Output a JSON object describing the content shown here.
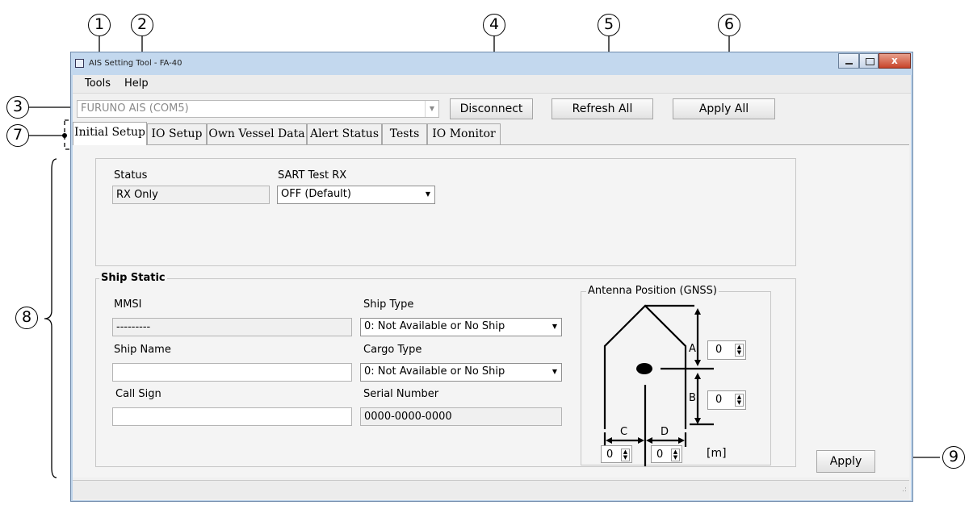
{
  "callouts": [
    "1",
    "2",
    "3",
    "4",
    "5",
    "6",
    "7",
    "8",
    "9"
  ],
  "window": {
    "title": "AIS Setting Tool - FA-40",
    "buttons": [
      "minimize-button",
      "maximize-button",
      "close-button"
    ]
  },
  "menu": {
    "tools": "Tools",
    "help": "Help"
  },
  "toolbar": {
    "port_value": "FURUNO AIS (COM5)",
    "disconnect": "Disconnect",
    "refresh_all": "Refresh All",
    "apply_all": "Apply All"
  },
  "tabs": [
    "Initial Setup",
    "IO Setup",
    "Own Vessel Data",
    "Alert Status",
    "Tests",
    "IO Monitor"
  ],
  "status_group": {
    "status_label": "Status",
    "status_value": "RX Only",
    "sart_label": "SART Test RX",
    "sart_value": "OFF (Default)"
  },
  "ship_static": {
    "title": "Ship Static",
    "mmsi_label": "MMSI",
    "mmsi_value": "---------",
    "ship_name_label": "Ship Name",
    "ship_name_value": "",
    "call_sign_label": "Call Sign",
    "call_sign_value": "",
    "ship_type_label": "Ship Type",
    "ship_type_value": "0: Not Available or No Ship",
    "cargo_type_label": "Cargo Type",
    "cargo_type_value": "0: Not Available or No Ship",
    "serial_label": "Serial Number",
    "serial_value": "0000-0000-0000"
  },
  "antenna": {
    "title": "Antenna Position (GNSS)",
    "a_label": "A",
    "b_label": "B",
    "c_label": "C",
    "d_label": "D",
    "a_value": "0",
    "b_value": "0",
    "c_value": "0",
    "d_value": "0",
    "unit": "[m]"
  },
  "apply": "Apply",
  "colors": {
    "titlebar": "#c3d8ee",
    "window_frame": "#bdd3ea",
    "close_button": "#c7442b"
  }
}
